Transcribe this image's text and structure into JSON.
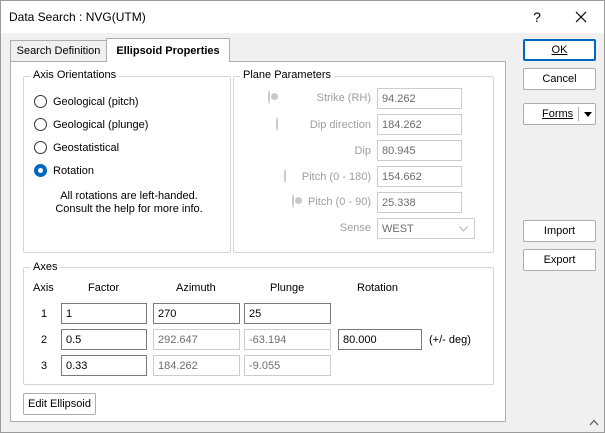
{
  "window": {
    "title": "Data Search : NVG(UTM)",
    "help_label": "?",
    "close_label": "✕"
  },
  "tabs": [
    {
      "label": "Search Definition"
    },
    {
      "label": "Ellipsoid Properties"
    }
  ],
  "axis_orientations": {
    "title": "Axis Orientations",
    "options": [
      {
        "label": "Geological (pitch)",
        "checked": false
      },
      {
        "label": "Geological (plunge)",
        "checked": false
      },
      {
        "label": "Geostatistical",
        "checked": false
      },
      {
        "label": "Rotation",
        "checked": true
      }
    ],
    "note_line1": "All rotations are left-handed.",
    "note_line2": "Consult the help for more info."
  },
  "plane_parameters": {
    "title": "Plane Parameters",
    "strike_label": "Strike (RH)",
    "strike_value": "94.262",
    "dip_direction_label": "Dip direction",
    "dip_direction_value": "184.262",
    "dip_label": "Dip",
    "dip_value": "80.945",
    "pitch180_label": "Pitch (0 - 180)",
    "pitch180_value": "154.662",
    "pitch90_label": "Pitch (0 - 90)",
    "pitch90_value": "25.338",
    "sense_label": "Sense",
    "sense_value": "WEST"
  },
  "axes": {
    "title": "Axes",
    "headers": {
      "axis": "Axis",
      "factor": "Factor",
      "azimuth": "Azimuth",
      "plunge": "Plunge",
      "rotation": "Rotation"
    },
    "rows": [
      {
        "axis": "1",
        "factor": "1",
        "azimuth": "270",
        "plunge": "25"
      },
      {
        "axis": "2",
        "factor": "0.5",
        "azimuth": "292.647",
        "plunge": "-63.194",
        "rotation": "80.000",
        "unit": "(+/- deg)"
      },
      {
        "axis": "3",
        "factor": "0.33",
        "azimuth": "184.262",
        "plunge": "-9.055"
      }
    ]
  },
  "buttons": {
    "edit_ellipsoid": "Edit Ellipsoid",
    "ok": "OK",
    "cancel": "Cancel",
    "forms": "Forms",
    "import": "Import",
    "export": "Export"
  }
}
